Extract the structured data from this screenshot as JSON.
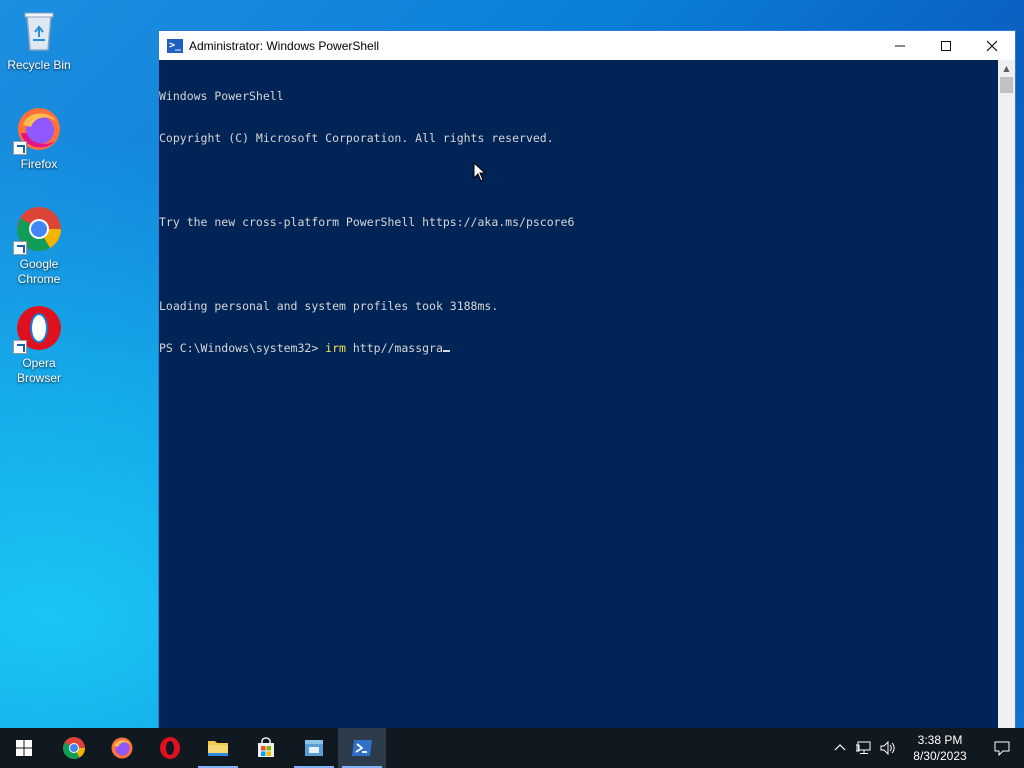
{
  "desktop": {
    "icons": [
      {
        "label": "Recycle Bin",
        "icon": "recycle-bin-icon"
      },
      {
        "label": "Firefox",
        "icon": "firefox-icon"
      },
      {
        "label": "Google\nChrome",
        "icon": "chrome-icon"
      },
      {
        "label": "Opera\nBrowser",
        "icon": "opera-icon"
      }
    ]
  },
  "window": {
    "title": "Administrator: Windows PowerShell",
    "controls": {
      "minimize": "—",
      "maximize": "☐",
      "close": "✕"
    },
    "console": {
      "lines": [
        "Windows PowerShell",
        "Copyright (C) Microsoft Corporation. All rights reserved.",
        "",
        "Try the new cross-platform PowerShell https://aka.ms/pscore6",
        "",
        "Loading personal and system profiles took 3188ms."
      ],
      "prompt": "PS C:\\Windows\\system32> ",
      "command": "irm",
      "argument": " http//massgra"
    }
  },
  "taskbar": {
    "apps": [
      "start-icon",
      "chrome-icon",
      "firefox-icon",
      "opera-icon",
      "file-explorer-icon",
      "store-icon",
      "app-icon",
      "powershell-icon"
    ],
    "clock": {
      "time": "3:38 PM",
      "date": "8/30/2023"
    }
  },
  "colors": {
    "console_bg": "#012456",
    "console_fg": "#d6d6d6",
    "command_fg": "#f0e25a"
  }
}
